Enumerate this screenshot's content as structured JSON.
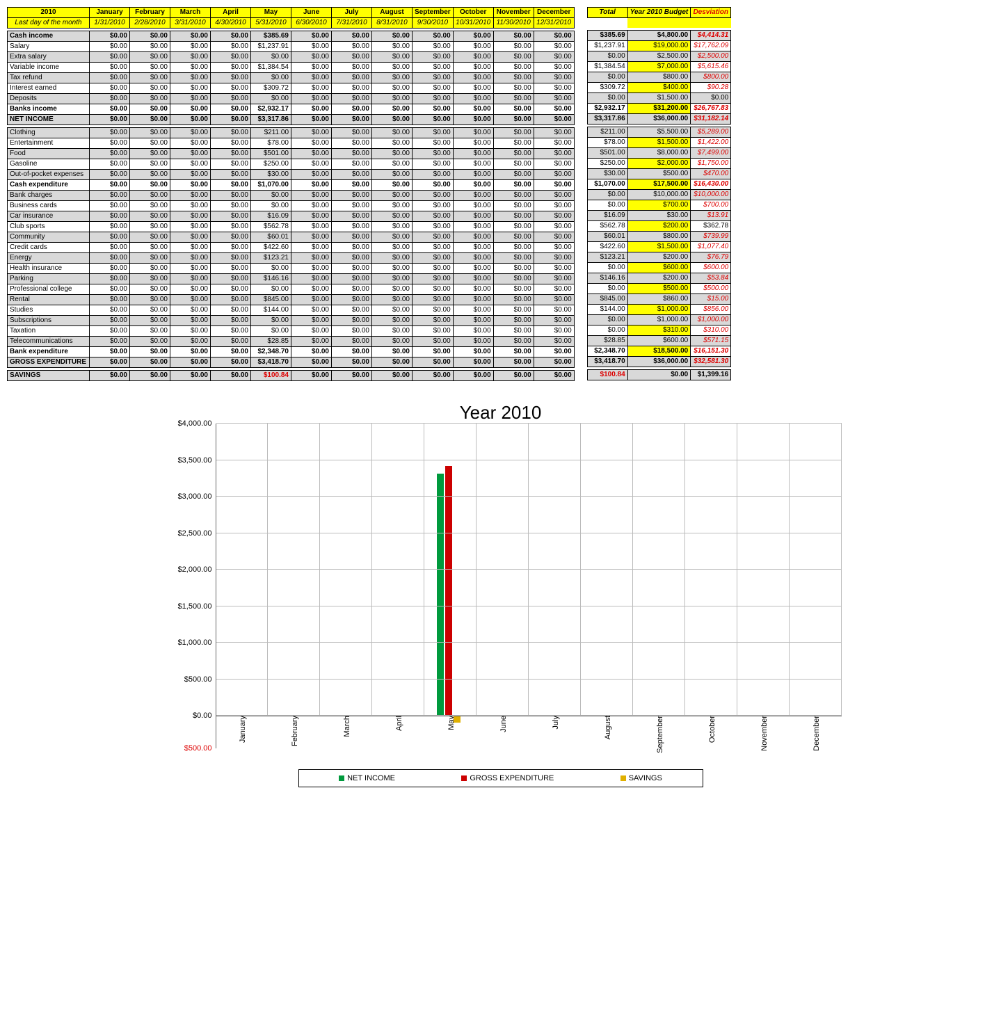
{
  "header": {
    "year": "2010",
    "sub": "Last day of the month",
    "months": [
      "January",
      "February",
      "March",
      "April",
      "May",
      "June",
      "July",
      "August",
      "September",
      "October",
      "November",
      "December"
    ],
    "dates": [
      "1/31/2010",
      "2/28/2010",
      "3/31/2010",
      "4/30/2010",
      "5/31/2010",
      "6/30/2010",
      "7/31/2010",
      "8/31/2010",
      "9/30/2010",
      "10/31/2010",
      "11/30/2010",
      "12/31/2010"
    ],
    "totals": [
      "Total",
      "Year 2010 Budget",
      "Desviation"
    ]
  },
  "rows": [
    {
      "label": "Cash income",
      "gray": true,
      "bold": true,
      "m": [
        "$0.00",
        "$0.00",
        "$0.00",
        "$0.00",
        "$385.69",
        "$0.00",
        "$0.00",
        "$0.00",
        "$0.00",
        "$0.00",
        "$0.00",
        "$0.00"
      ],
      "t": "$385.69",
      "b": "$4,800.00",
      "d": "$4,414.31"
    },
    {
      "label": "Salary",
      "m": [
        "$0.00",
        "$0.00",
        "$0.00",
        "$0.00",
        "$1,237.91",
        "$0.00",
        "$0.00",
        "$0.00",
        "$0.00",
        "$0.00",
        "$0.00",
        "$0.00"
      ],
      "t": "$1,237.91",
      "b": "$19,000.00",
      "d": "$17,762.09"
    },
    {
      "label": "Extra salary",
      "gray": true,
      "m": [
        "$0.00",
        "$0.00",
        "$0.00",
        "$0.00",
        "$0.00",
        "$0.00",
        "$0.00",
        "$0.00",
        "$0.00",
        "$0.00",
        "$0.00",
        "$0.00"
      ],
      "t": "$0.00",
      "b": "$2,500.00",
      "d": "$2,500.00"
    },
    {
      "label": "Variable income",
      "m": [
        "$0.00",
        "$0.00",
        "$0.00",
        "$0.00",
        "$1,384.54",
        "$0.00",
        "$0.00",
        "$0.00",
        "$0.00",
        "$0.00",
        "$0.00",
        "$0.00"
      ],
      "t": "$1,384.54",
      "b": "$7,000.00",
      "d": "$5,615.46"
    },
    {
      "label": "Tax refund",
      "gray": true,
      "m": [
        "$0.00",
        "$0.00",
        "$0.00",
        "$0.00",
        "$0.00",
        "$0.00",
        "$0.00",
        "$0.00",
        "$0.00",
        "$0.00",
        "$0.00",
        "$0.00"
      ],
      "t": "$0.00",
      "b": "$800.00",
      "d": "$800.00"
    },
    {
      "label": "Interest earned",
      "m": [
        "$0.00",
        "$0.00",
        "$0.00",
        "$0.00",
        "$309.72",
        "$0.00",
        "$0.00",
        "$0.00",
        "$0.00",
        "$0.00",
        "$0.00",
        "$0.00"
      ],
      "t": "$309.72",
      "b": "$400.00",
      "d": "$90.28"
    },
    {
      "label": "Deposits",
      "gray": true,
      "m": [
        "$0.00",
        "$0.00",
        "$0.00",
        "$0.00",
        "$0.00",
        "$0.00",
        "$0.00",
        "$0.00",
        "$0.00",
        "$0.00",
        "$0.00",
        "$0.00"
      ],
      "t": "$0.00",
      "b": "$1,500.00",
      "d": "$0.00",
      "nodev": true
    },
    {
      "label": "Banks income",
      "bold": true,
      "m": [
        "$0.00",
        "$0.00",
        "$0.00",
        "$0.00",
        "$2,932.17",
        "$0.00",
        "$0.00",
        "$0.00",
        "$0.00",
        "$0.00",
        "$0.00",
        "$0.00"
      ],
      "t": "$2,932.17",
      "b": "$31,200.00",
      "d": "$26,767.83"
    },
    {
      "label": "NET INCOME",
      "gray": true,
      "bold": true,
      "m": [
        "$0.00",
        "$0.00",
        "$0.00",
        "$0.00",
        "$3,317.86",
        "$0.00",
        "$0.00",
        "$0.00",
        "$0.00",
        "$0.00",
        "$0.00",
        "$0.00"
      ],
      "t": "$3,317.86",
      "b": "$36,000.00",
      "d": "$31,182.14"
    },
    {
      "spacer": true
    },
    {
      "label": "Clothing",
      "gray": true,
      "m": [
        "$0.00",
        "$0.00",
        "$0.00",
        "$0.00",
        "$211.00",
        "$0.00",
        "$0.00",
        "$0.00",
        "$0.00",
        "$0.00",
        "$0.00",
        "$0.00"
      ],
      "t": "$211.00",
      "b": "$5,500.00",
      "d": "$5,289.00"
    },
    {
      "label": "Entertainment",
      "m": [
        "$0.00",
        "$0.00",
        "$0.00",
        "$0.00",
        "$78.00",
        "$0.00",
        "$0.00",
        "$0.00",
        "$0.00",
        "$0.00",
        "$0.00",
        "$0.00"
      ],
      "t": "$78.00",
      "b": "$1,500.00",
      "d": "$1,422.00"
    },
    {
      "label": "Food",
      "gray": true,
      "m": [
        "$0.00",
        "$0.00",
        "$0.00",
        "$0.00",
        "$501.00",
        "$0.00",
        "$0.00",
        "$0.00",
        "$0.00",
        "$0.00",
        "$0.00",
        "$0.00"
      ],
      "t": "$501.00",
      "b": "$8,000.00",
      "d": "$7,499.00"
    },
    {
      "label": "Gasoline",
      "m": [
        "$0.00",
        "$0.00",
        "$0.00",
        "$0.00",
        "$250.00",
        "$0.00",
        "$0.00",
        "$0.00",
        "$0.00",
        "$0.00",
        "$0.00",
        "$0.00"
      ],
      "t": "$250.00",
      "b": "$2,000.00",
      "d": "$1,750.00"
    },
    {
      "label": "Out-of-pocket expenses",
      "gray": true,
      "m": [
        "$0.00",
        "$0.00",
        "$0.00",
        "$0.00",
        "$30.00",
        "$0.00",
        "$0.00",
        "$0.00",
        "$0.00",
        "$0.00",
        "$0.00",
        "$0.00"
      ],
      "t": "$30.00",
      "b": "$500.00",
      "d": "$470.00"
    },
    {
      "label": "Cash expenditure",
      "bold": true,
      "m": [
        "$0.00",
        "$0.00",
        "$0.00",
        "$0.00",
        "$1,070.00",
        "$0.00",
        "$0.00",
        "$0.00",
        "$0.00",
        "$0.00",
        "$0.00",
        "$0.00"
      ],
      "t": "$1,070.00",
      "b": "$17,500.00",
      "d": "$16,430.00"
    },
    {
      "label": "Bank charges",
      "gray": true,
      "m": [
        "$0.00",
        "$0.00",
        "$0.00",
        "$0.00",
        "$0.00",
        "$0.00",
        "$0.00",
        "$0.00",
        "$0.00",
        "$0.00",
        "$0.00",
        "$0.00"
      ],
      "t": "$0.00",
      "b": "$10,000.00",
      "d": "$10,000.00"
    },
    {
      "label": "Business cards",
      "m": [
        "$0.00",
        "$0.00",
        "$0.00",
        "$0.00",
        "$0.00",
        "$0.00",
        "$0.00",
        "$0.00",
        "$0.00",
        "$0.00",
        "$0.00",
        "$0.00"
      ],
      "t": "$0.00",
      "b": "$700.00",
      "d": "$700.00"
    },
    {
      "label": "Car insurance",
      "gray": true,
      "m": [
        "$0.00",
        "$0.00",
        "$0.00",
        "$0.00",
        "$16.09",
        "$0.00",
        "$0.00",
        "$0.00",
        "$0.00",
        "$0.00",
        "$0.00",
        "$0.00"
      ],
      "t": "$16.09",
      "b": "$30.00",
      "d": "$13.91"
    },
    {
      "label": "Club sports",
      "m": [
        "$0.00",
        "$0.00",
        "$0.00",
        "$0.00",
        "$562.78",
        "$0.00",
        "$0.00",
        "$0.00",
        "$0.00",
        "$0.00",
        "$0.00",
        "$0.00"
      ],
      "t": "$562.78",
      "b": "$200.00",
      "d": "$362.78",
      "nodev": true
    },
    {
      "label": "Community",
      "gray": true,
      "m": [
        "$0.00",
        "$0.00",
        "$0.00",
        "$0.00",
        "$60.01",
        "$0.00",
        "$0.00",
        "$0.00",
        "$0.00",
        "$0.00",
        "$0.00",
        "$0.00"
      ],
      "t": "$60.01",
      "b": "$800.00",
      "d": "$739.99"
    },
    {
      "label": "Credit cards",
      "m": [
        "$0.00",
        "$0.00",
        "$0.00",
        "$0.00",
        "$422.60",
        "$0.00",
        "$0.00",
        "$0.00",
        "$0.00",
        "$0.00",
        "$0.00",
        "$0.00"
      ],
      "t": "$422.60",
      "b": "$1,500.00",
      "d": "$1,077.40"
    },
    {
      "label": "Energy",
      "gray": true,
      "m": [
        "$0.00",
        "$0.00",
        "$0.00",
        "$0.00",
        "$123.21",
        "$0.00",
        "$0.00",
        "$0.00",
        "$0.00",
        "$0.00",
        "$0.00",
        "$0.00"
      ],
      "t": "$123.21",
      "b": "$200.00",
      "d": "$76.79"
    },
    {
      "label": "Health insurance",
      "m": [
        "$0.00",
        "$0.00",
        "$0.00",
        "$0.00",
        "$0.00",
        "$0.00",
        "$0.00",
        "$0.00",
        "$0.00",
        "$0.00",
        "$0.00",
        "$0.00"
      ],
      "t": "$0.00",
      "b": "$600.00",
      "d": "$600.00"
    },
    {
      "label": "Parking",
      "gray": true,
      "m": [
        "$0.00",
        "$0.00",
        "$0.00",
        "$0.00",
        "$146.16",
        "$0.00",
        "$0.00",
        "$0.00",
        "$0.00",
        "$0.00",
        "$0.00",
        "$0.00"
      ],
      "t": "$146.16",
      "b": "$200.00",
      "d": "$53.84"
    },
    {
      "label": "Professional college",
      "m": [
        "$0.00",
        "$0.00",
        "$0.00",
        "$0.00",
        "$0.00",
        "$0.00",
        "$0.00",
        "$0.00",
        "$0.00",
        "$0.00",
        "$0.00",
        "$0.00"
      ],
      "t": "$0.00",
      "b": "$500.00",
      "d": "$500.00"
    },
    {
      "label": "Rental",
      "gray": true,
      "m": [
        "$0.00",
        "$0.00",
        "$0.00",
        "$0.00",
        "$845.00",
        "$0.00",
        "$0.00",
        "$0.00",
        "$0.00",
        "$0.00",
        "$0.00",
        "$0.00"
      ],
      "t": "$845.00",
      "b": "$860.00",
      "d": "$15.00"
    },
    {
      "label": "Studies",
      "m": [
        "$0.00",
        "$0.00",
        "$0.00",
        "$0.00",
        "$144.00",
        "$0.00",
        "$0.00",
        "$0.00",
        "$0.00",
        "$0.00",
        "$0.00",
        "$0.00"
      ],
      "t": "$144.00",
      "b": "$1,000.00",
      "d": "$856.00"
    },
    {
      "label": "Subscriptions",
      "gray": true,
      "m": [
        "$0.00",
        "$0.00",
        "$0.00",
        "$0.00",
        "$0.00",
        "$0.00",
        "$0.00",
        "$0.00",
        "$0.00",
        "$0.00",
        "$0.00",
        "$0.00"
      ],
      "t": "$0.00",
      "b": "$1,000.00",
      "d": "$1,000.00"
    },
    {
      "label": "Taxation",
      "m": [
        "$0.00",
        "$0.00",
        "$0.00",
        "$0.00",
        "$0.00",
        "$0.00",
        "$0.00",
        "$0.00",
        "$0.00",
        "$0.00",
        "$0.00",
        "$0.00"
      ],
      "t": "$0.00",
      "b": "$310.00",
      "d": "$310.00"
    },
    {
      "label": "Telecommunications",
      "gray": true,
      "m": [
        "$0.00",
        "$0.00",
        "$0.00",
        "$0.00",
        "$28.85",
        "$0.00",
        "$0.00",
        "$0.00",
        "$0.00",
        "$0.00",
        "$0.00",
        "$0.00"
      ],
      "t": "$28.85",
      "b": "$600.00",
      "d": "$571.15"
    },
    {
      "label": "Bank expenditure",
      "bold": true,
      "m": [
        "$0.00",
        "$0.00",
        "$0.00",
        "$0.00",
        "$2,348.70",
        "$0.00",
        "$0.00",
        "$0.00",
        "$0.00",
        "$0.00",
        "$0.00",
        "$0.00"
      ],
      "t": "$2,348.70",
      "b": "$18,500.00",
      "d": "$16,151.30"
    },
    {
      "label": "GROSS EXPENDITURE",
      "gray": true,
      "bold": true,
      "m": [
        "$0.00",
        "$0.00",
        "$0.00",
        "$0.00",
        "$3,418.70",
        "$0.00",
        "$0.00",
        "$0.00",
        "$0.00",
        "$0.00",
        "$0.00",
        "$0.00"
      ],
      "t": "$3,418.70",
      "b": "$36,000.00",
      "d": "$32,581.30"
    },
    {
      "spacer": true
    },
    {
      "label": "SAVINGS",
      "gray": true,
      "bold": true,
      "m": [
        "$0.00",
        "$0.00",
        "$0.00",
        "$0.00",
        "$100.84",
        "$0.00",
        "$0.00",
        "$0.00",
        "$0.00",
        "$0.00",
        "$0.00",
        "$0.00"
      ],
      "mred": 4,
      "t": "$100.84",
      "tred": true,
      "b": "$0.00",
      "d": "$1,399.16",
      "nodev": true
    }
  ],
  "chart_data": {
    "type": "bar",
    "title": "Year 2010",
    "categories": [
      "January",
      "February",
      "March",
      "April",
      "May",
      "June",
      "July",
      "August",
      "September",
      "October",
      "November",
      "December"
    ],
    "series": [
      {
        "name": "NET INCOME",
        "color": "#009a3d",
        "values": [
          0,
          0,
          0,
          0,
          3317.86,
          0,
          0,
          0,
          0,
          0,
          0,
          0
        ]
      },
      {
        "name": "GROSS EXPENDITURE",
        "color": "#cc0000",
        "values": [
          0,
          0,
          0,
          0,
          3418.7,
          0,
          0,
          0,
          0,
          0,
          0,
          0
        ]
      },
      {
        "name": "SAVINGS",
        "color": "#e0b000",
        "values": [
          0,
          0,
          0,
          0,
          -100.84,
          0,
          0,
          0,
          0,
          0,
          0,
          0
        ]
      }
    ],
    "yticks": [
      0,
      500,
      1000,
      1500,
      2000,
      2500,
      3000,
      3500,
      4000
    ],
    "ylabels": [
      "$0.00",
      "$500.00",
      "$1,000.00",
      "$1,500.00",
      "$2,000.00",
      "$2,500.00",
      "$3,000.00",
      "$3,500.00",
      "$4,000.00"
    ],
    "ylim": [
      -500,
      4000
    ],
    "neglabel": "$500.00"
  }
}
